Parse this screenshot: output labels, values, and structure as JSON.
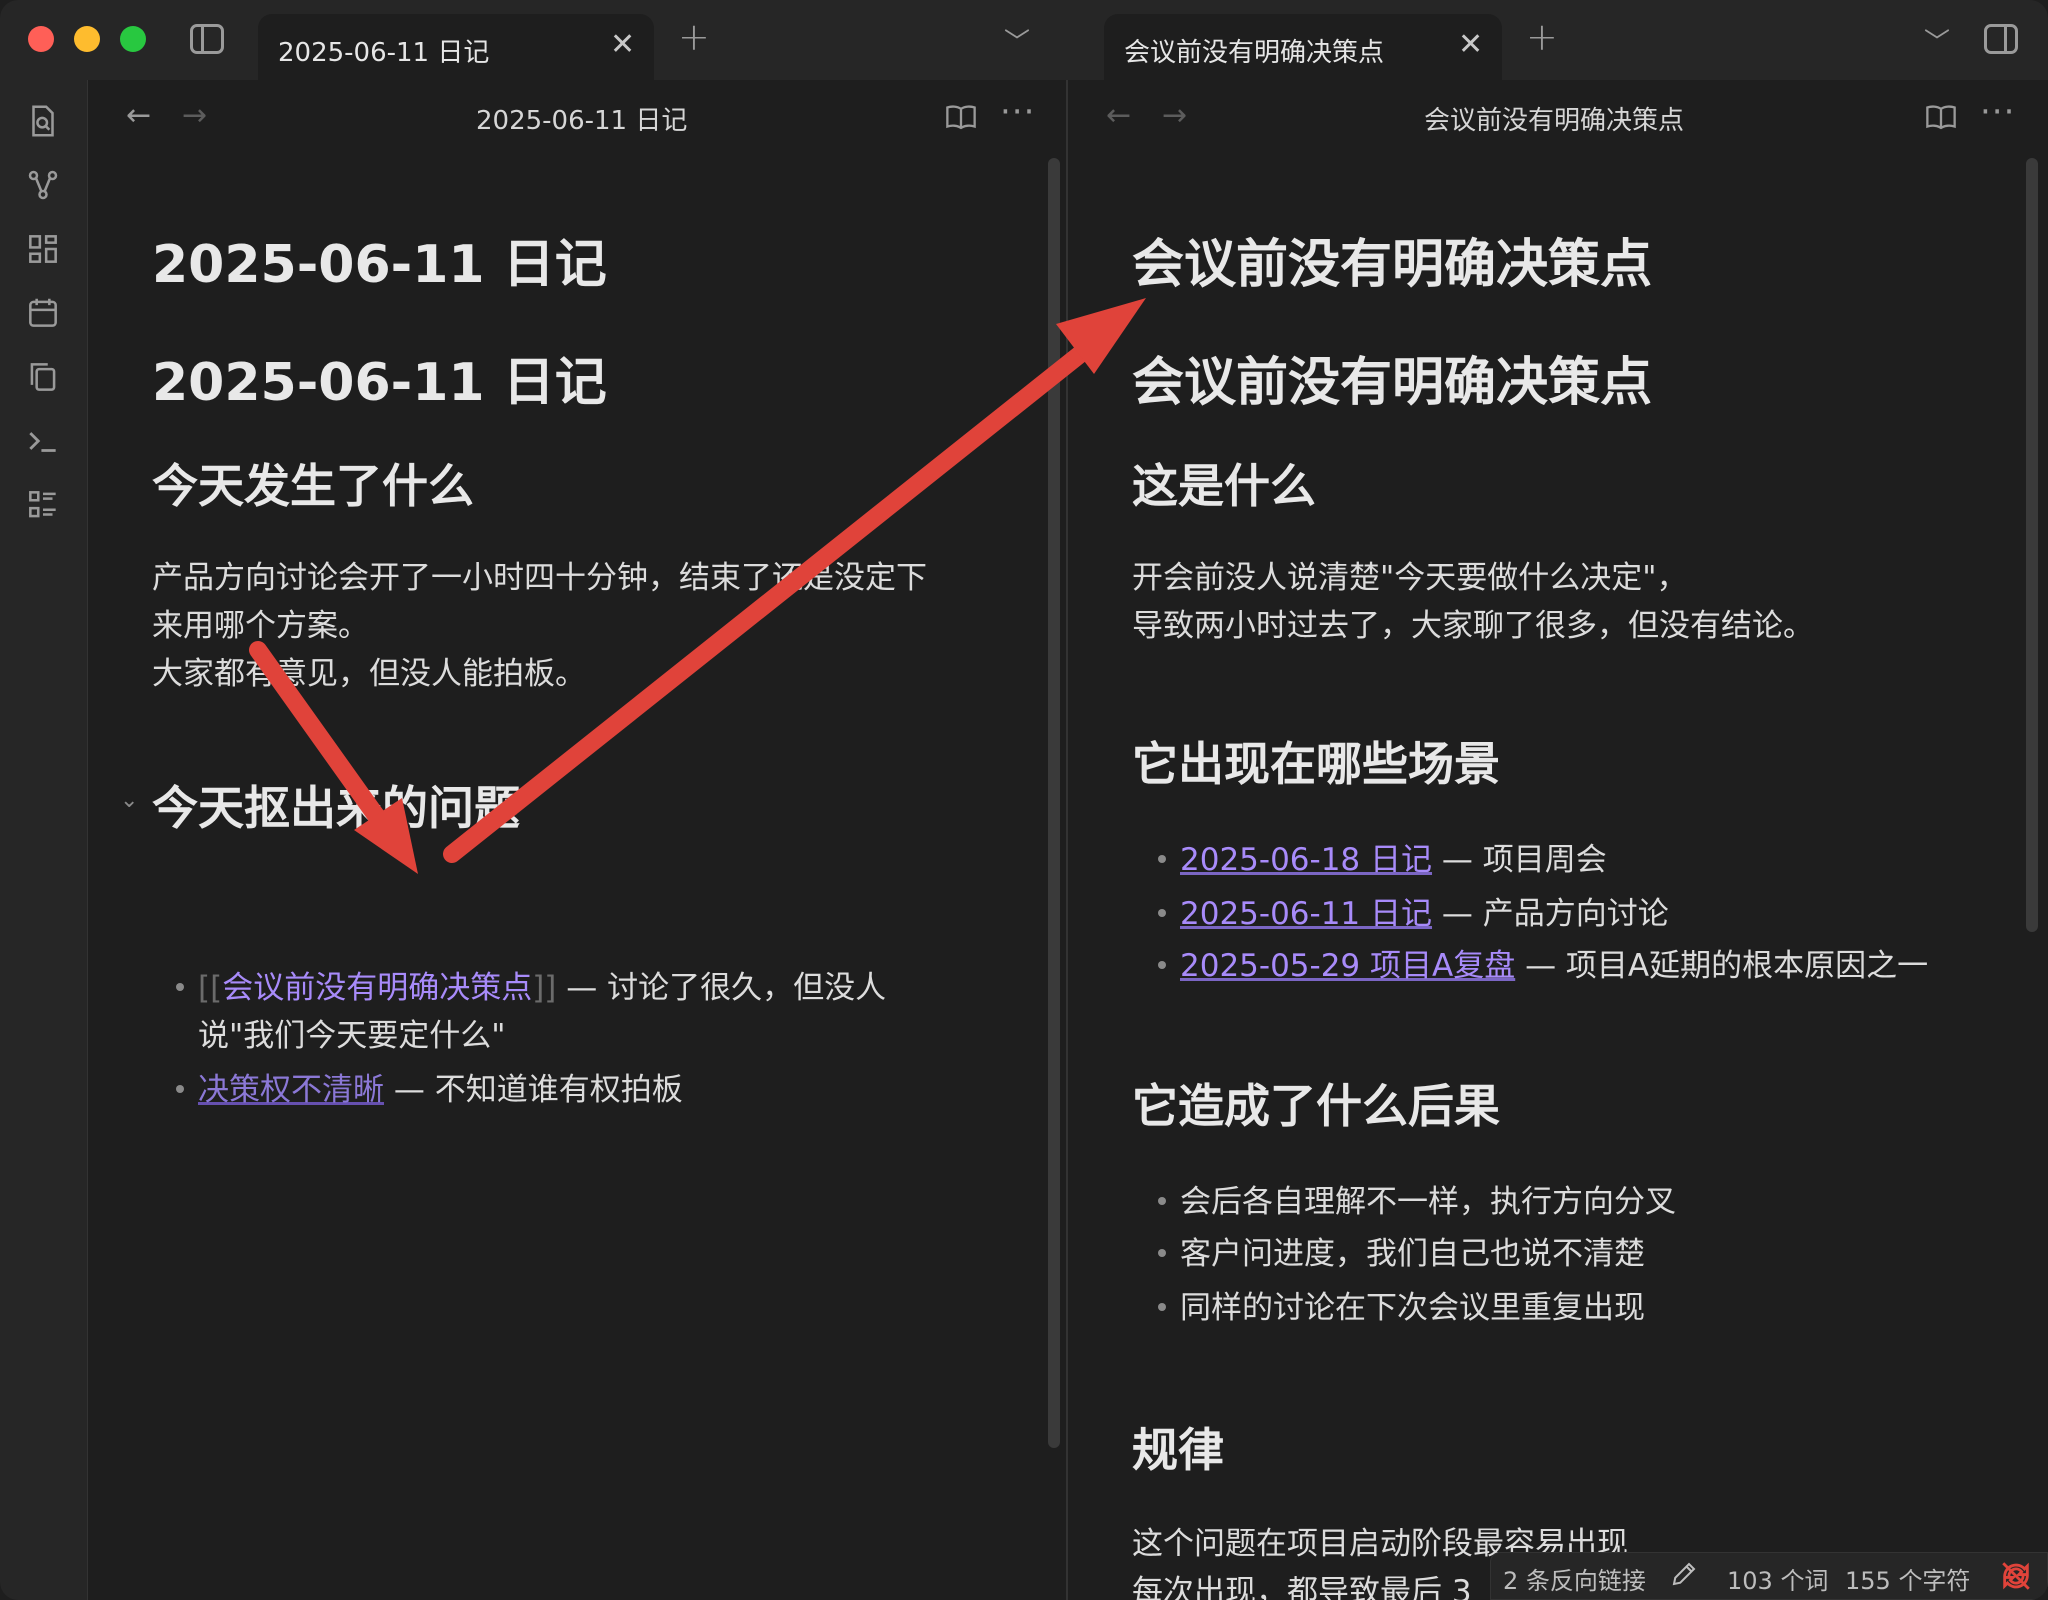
{
  "tabs": [
    {
      "label": "2025-06-11 日记",
      "close": "✕"
    },
    {
      "label": "会议前没有明确决策点",
      "close": "✕"
    }
  ],
  "left_pane": {
    "title": "2025-06-11 日记",
    "inline_title": "2025-06-11 日记",
    "h1": "2025-06-11 日记",
    "h2_today": "今天发生了什么",
    "para_lines": [
      "产品方向讨论会开了一小时四十分钟，结束了还是没定下",
      "来用哪个方案。",
      "大家都有意见，但没人能拍板。"
    ],
    "h2_issues": "今天抠出来的问题",
    "bullets": [
      {
        "open": "[[",
        "link": "会议前没有明确决策点",
        "close": "]]",
        "rest": " — 讨论了很久，但没人",
        "cont": "说\"我们今天要定什么\""
      },
      {
        "link": "决策权不清晰",
        "rest": " — 不知道谁有权拍板"
      }
    ]
  },
  "right_pane": {
    "title": "会议前没有明确决策点",
    "inline_title": "会议前没有明确决策点",
    "h1": "会议前没有明确决策点",
    "h2_what": "这是什么",
    "para_lines": [
      "开会前没人说清楚\"今天要做什么决定\"，",
      "导致两小时过去了，大家聊了很多，但没有结论。"
    ],
    "h2_scenes": "它出现在哪些场景",
    "scene_bullets": [
      {
        "link": "2025-06-18 日记",
        "rest": " — 项目周会"
      },
      {
        "link": "2025-06-11 日记",
        "rest": " — 产品方向讨论"
      },
      {
        "link": "2025-05-29 项目A复盘",
        "rest": " — 项目A延期的根本原因之一"
      }
    ],
    "h2_effects": "它造成了什么后果",
    "effect_bullets": [
      "会后各自理解不一样，执行方向分叉",
      "客户问进度，我们自己也说不清楚",
      "同样的讨论在下次会议里重复出现"
    ],
    "h2_pattern": "规律",
    "pattern_lines": [
      "这个问题在项目启动阶段最容易出现",
      "每次出现，都导致最后 3"
    ]
  },
  "status_bar": {
    "backlinks": "2 条反向链接",
    "words": "103 个词",
    "chars": "155 个字符"
  },
  "colors": {
    "background": "#1e1e1e",
    "link": "#a88bfa",
    "annotation_arrow": "#e0433a"
  }
}
